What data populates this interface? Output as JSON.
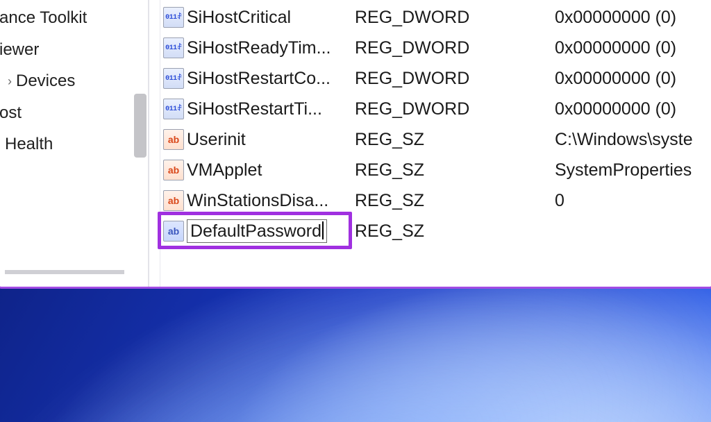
{
  "tree": {
    "items": [
      {
        "label": "ance Toolkit",
        "indent": "indent0",
        "expandable": false
      },
      {
        "label": "iewer",
        "indent": "indent0",
        "expandable": false
      },
      {
        "label": "Devices",
        "indent": "indent1",
        "expandable": true
      },
      {
        "label": "ost",
        "indent": "indent0",
        "expandable": false
      },
      {
        "label": "",
        "indent": "indent0",
        "expandable": false
      },
      {
        "label": "Health",
        "indent": "indent1",
        "expandable": false
      }
    ]
  },
  "values": [
    {
      "icon": "dword",
      "name": "SiHostCritical",
      "type": "REG_DWORD",
      "data": "0x00000000 (0)"
    },
    {
      "icon": "dword",
      "name": "SiHostReadyTim...",
      "type": "REG_DWORD",
      "data": "0x00000000 (0)"
    },
    {
      "icon": "dword",
      "name": "SiHostRestartCo...",
      "type": "REG_DWORD",
      "data": "0x00000000 (0)"
    },
    {
      "icon": "dword",
      "name": "SiHostRestartTi...",
      "type": "REG_DWORD",
      "data": "0x00000000 (0)"
    },
    {
      "icon": "sz",
      "name": "Userinit",
      "type": "REG_SZ",
      "data": "C:\\Windows\\syste"
    },
    {
      "icon": "sz",
      "name": "VMApplet",
      "type": "REG_SZ",
      "data": "SystemProperties"
    },
    {
      "icon": "sz",
      "name": "WinStationsDisa...",
      "type": "REG_SZ",
      "data": "0"
    }
  ],
  "editing": {
    "icon": "sz",
    "name": "DefaultPassword",
    "type": "REG_SZ",
    "data": ""
  }
}
